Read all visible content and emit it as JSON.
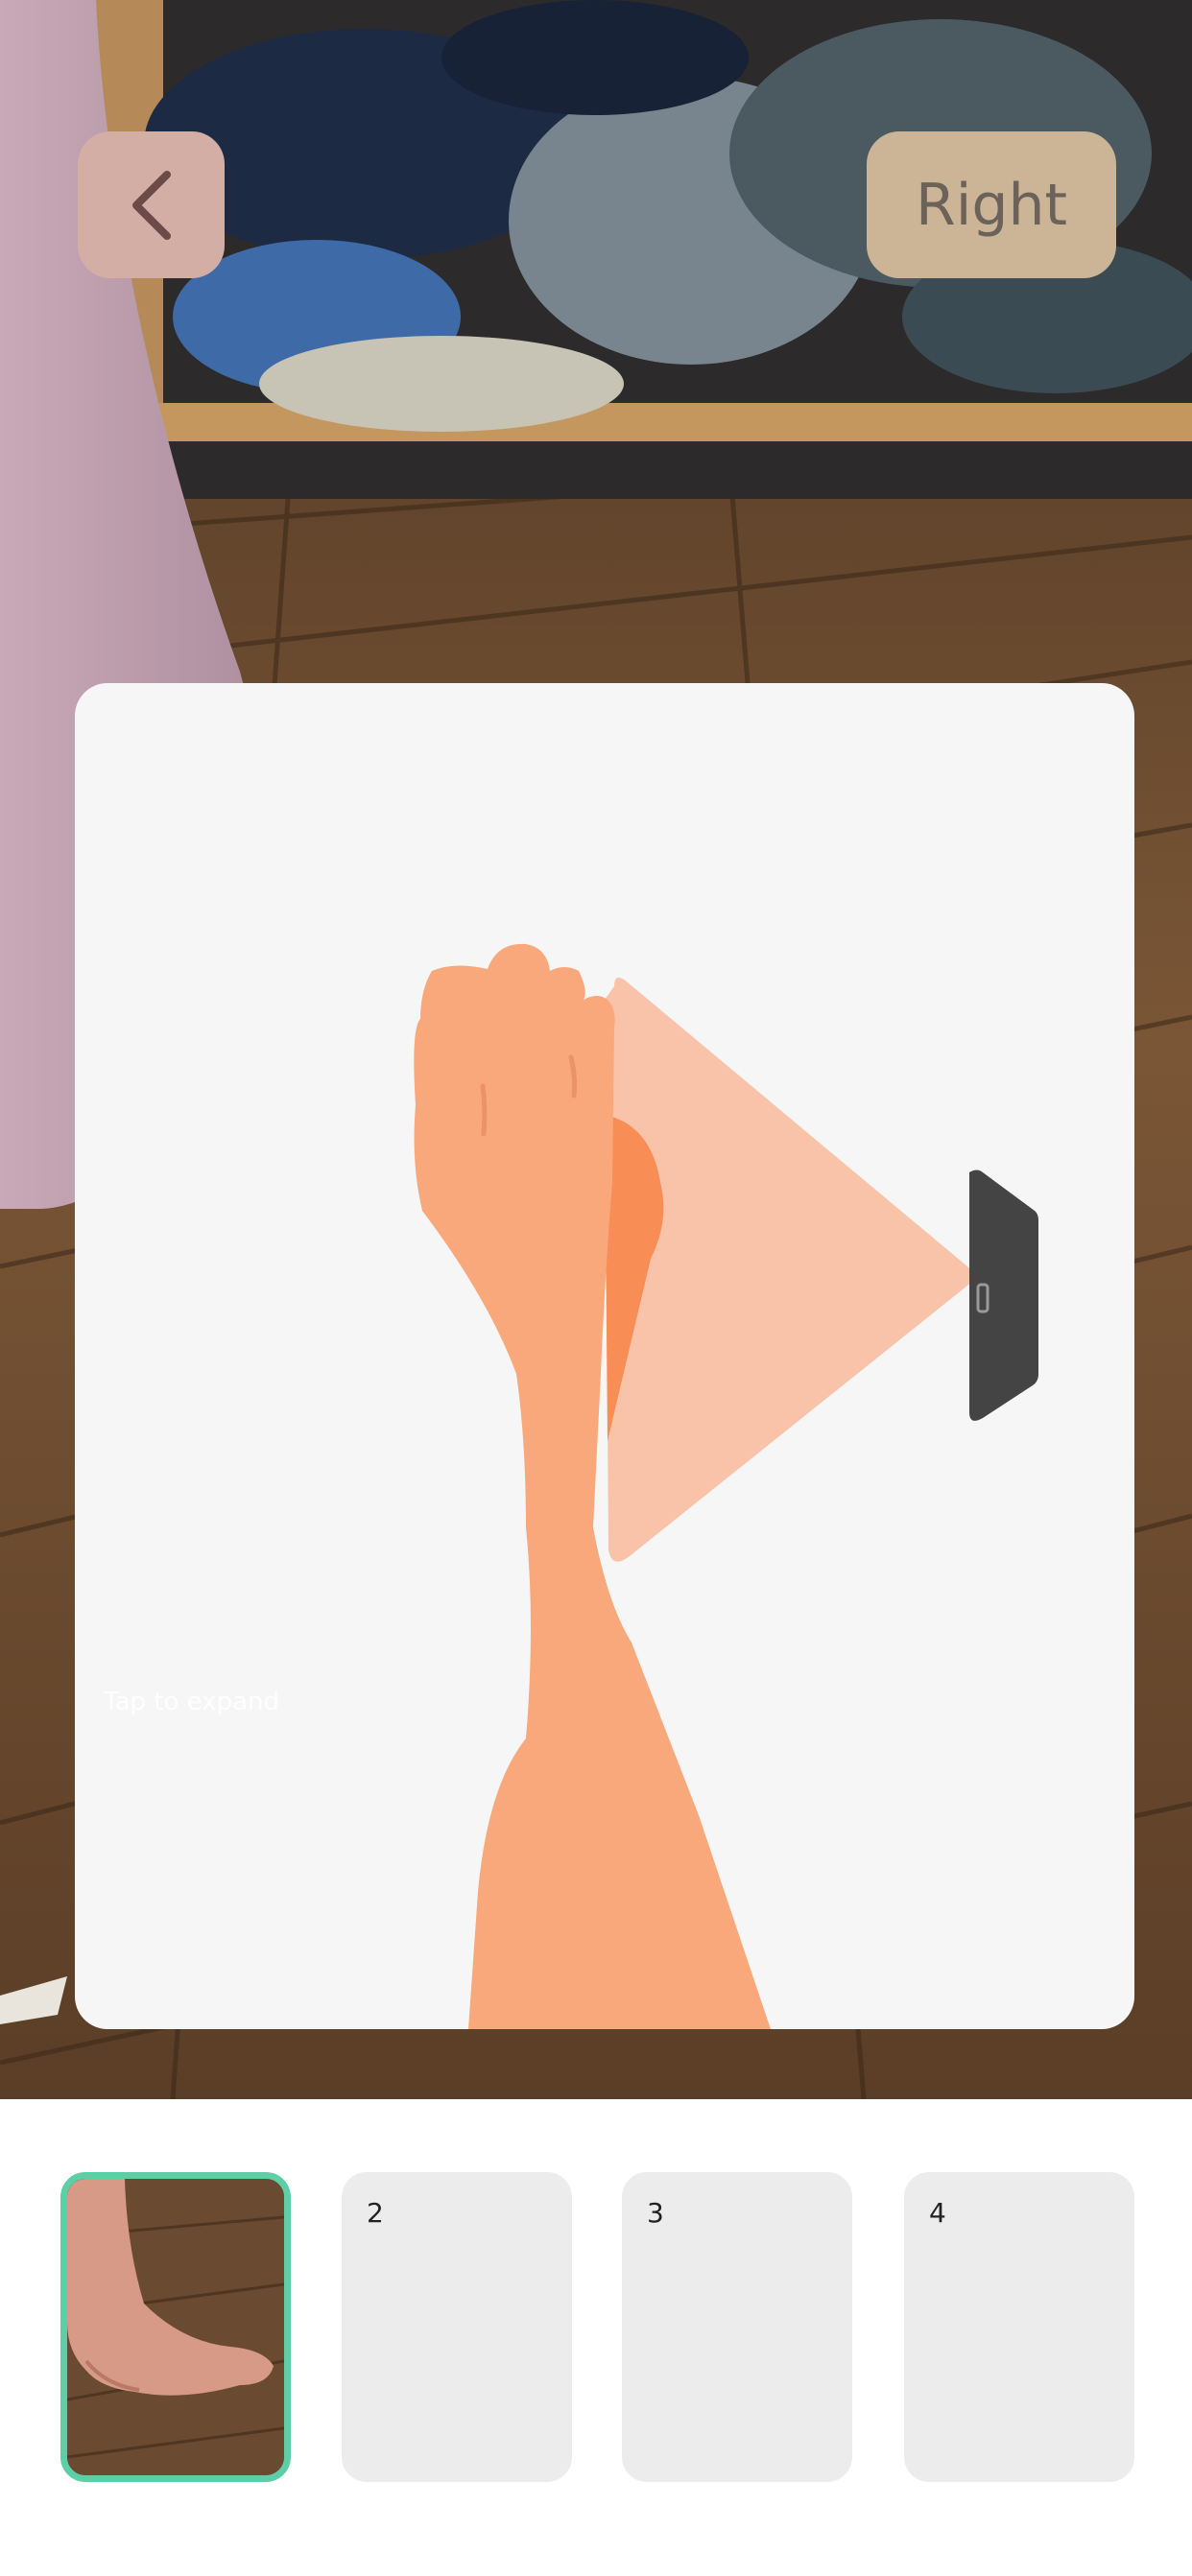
{
  "header": {
    "back_icon": "chevron-left-icon",
    "side_label": "Right"
  },
  "instruction": {
    "expand_hint": "Tap to expand",
    "colors": {
      "card": "#f6f6f6",
      "foot": "#f9a87b",
      "foot_shadow": "#f98d56",
      "camera_cone": "#f9c3aa",
      "phone": "#444444"
    }
  },
  "thumbnails": [
    {
      "label": "",
      "selected": true
    },
    {
      "label": "2",
      "selected": false
    },
    {
      "label": "3",
      "selected": false
    },
    {
      "label": "4",
      "selected": false
    }
  ],
  "colors": {
    "back_button": "#d3aea4",
    "side_button": "#ccb497",
    "selected_border": "#5ccfa6"
  }
}
